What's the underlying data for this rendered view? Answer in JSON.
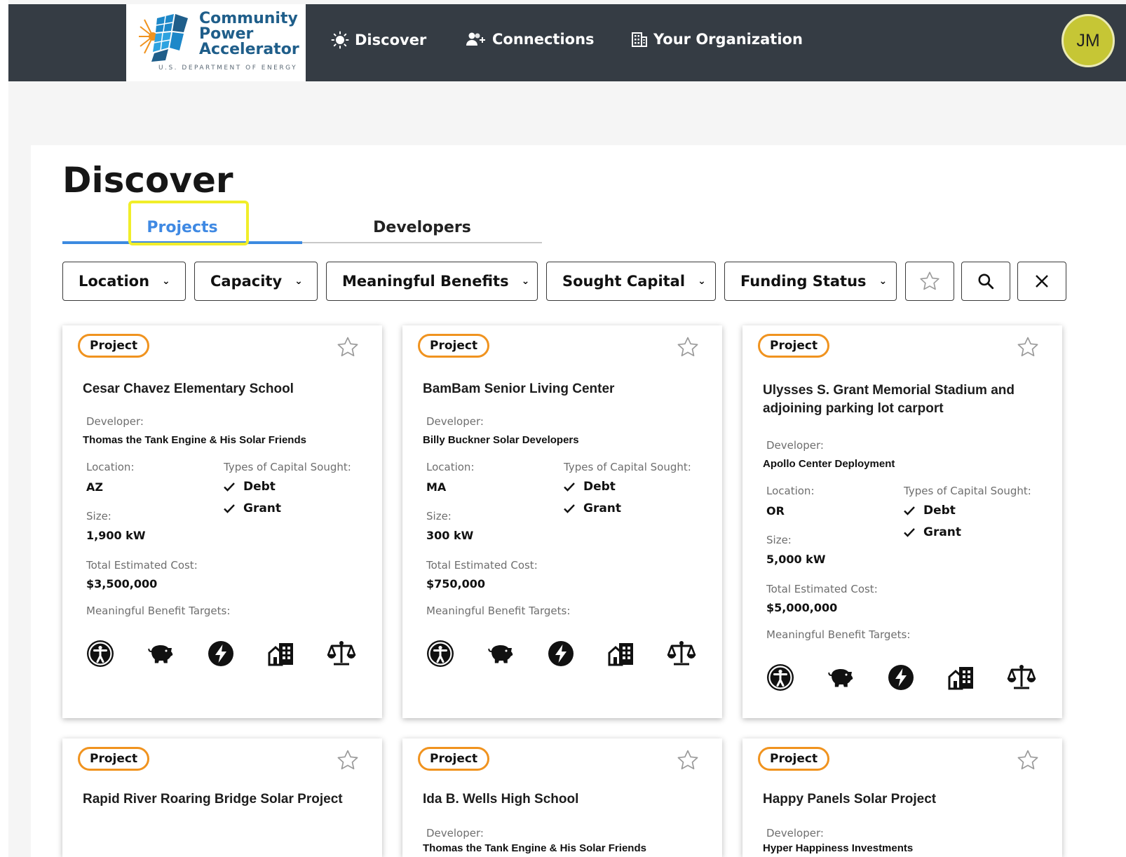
{
  "header": {
    "logo": {
      "line1": "Community",
      "line2": "Power",
      "line3": "Accelerator",
      "sub": "U.S. DEPARTMENT OF ENERGY"
    },
    "nav": [
      {
        "label": "Discover",
        "icon": "sun-icon"
      },
      {
        "label": "Connections",
        "icon": "people-plus-icon"
      },
      {
        "label": "Your Organization",
        "icon": "building-icon"
      }
    ],
    "avatar_initials": "JM"
  },
  "page": {
    "title": "Discover",
    "tabs": [
      {
        "label": "Projects",
        "active": true
      },
      {
        "label": "Developers",
        "active": false
      }
    ]
  },
  "filters": [
    {
      "label": "Location"
    },
    {
      "label": "Capacity"
    },
    {
      "label": "Meaningful Benefits"
    },
    {
      "label": "Sought Capital"
    },
    {
      "label": "Funding Status"
    }
  ],
  "filter_icons": [
    "star-icon",
    "search-icon",
    "close-icon"
  ],
  "labels": {
    "badge": "Project",
    "developer": "Developer:",
    "location": "Location:",
    "types": "Types of Capital Sought:",
    "size": "Size:",
    "cost": "Total Estimated Cost:",
    "benefits": "Meaningful Benefit Targets:"
  },
  "projects": [
    {
      "title": "Cesar Chavez Elementary School",
      "developer": "Thomas the Tank Engine & His Solar Friends",
      "location": "AZ",
      "size": "1,900 kW",
      "cost": "$3,500,000",
      "capital": [
        "Debt",
        "Grant"
      ]
    },
    {
      "title": "BamBam Senior Living Center",
      "developer": "Billy Buckner Solar Developers",
      "location": "MA",
      "size": "300 kW",
      "cost": "$750,000",
      "capital": [
        "Debt",
        "Grant"
      ]
    },
    {
      "title_line1": "Ulysses S. Grant Memorial Stadium and",
      "title_line2": "adjoining parking lot carport",
      "developer": "Apollo Center Deployment",
      "location": "OR",
      "size": "5,000 kW",
      "cost": "$5,000,000",
      "capital": [
        "Debt",
        "Grant"
      ]
    },
    {
      "title": "Rapid River Roaring Bridge Solar Project"
    },
    {
      "title": "Ida B. Wells High School",
      "developer": "Thomas the Tank Engine & His Solar Friends"
    },
    {
      "title": "Happy Panels Solar Project",
      "developer": "Hyper Happiness Investments"
    }
  ],
  "benefit_icons": [
    "accessibility-icon",
    "piggy-bank-icon",
    "energy-bolt-icon",
    "community-building-icon",
    "justice-scale-icon"
  ],
  "colors": {
    "topbar": "#353c44",
    "tab_active": "#3f89e3",
    "badge_border": "#f0931f",
    "avatar": "#c6c635",
    "highlight": "#f1ee2a"
  }
}
